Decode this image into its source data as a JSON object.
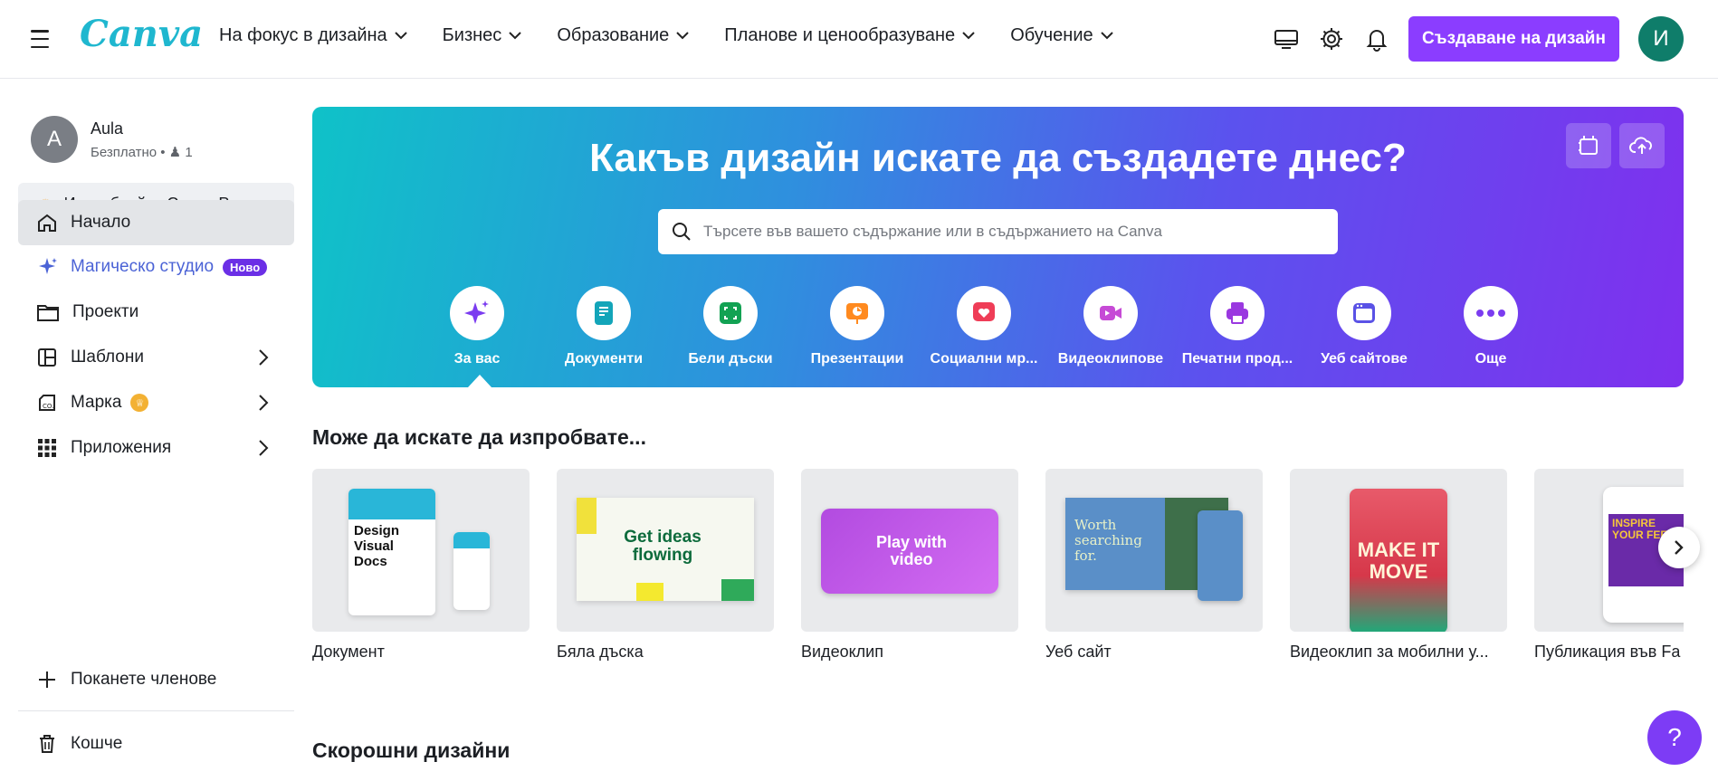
{
  "topbar": {
    "logo": "Canva",
    "nav": [
      "На фокус в дизайна",
      "Бизнес",
      "Образование",
      "Планове и ценообразуване",
      "Обучение"
    ],
    "create_label": "Създаване на дизайн",
    "avatar_letter": "И",
    "icons": [
      "desktop-icon",
      "gear-icon",
      "bell-icon"
    ]
  },
  "sidebar": {
    "user": {
      "initial": "A",
      "name": "Aula",
      "plan": "Безплатно • ",
      "members": "1"
    },
    "pro_label": "Изпробвайте Canva Pro",
    "items": [
      {
        "label": "Начало"
      },
      {
        "label": "Магическо студио",
        "badge": "Ново"
      },
      {
        "label": "Проекти"
      },
      {
        "label": "Шаблони"
      },
      {
        "label": "Марка"
      },
      {
        "label": "Приложения"
      }
    ],
    "invite_label": "Поканете членове",
    "trash_label": "Кошче"
  },
  "hero": {
    "title": "Какъв дизайн искате да създадете днес?",
    "search_placeholder": "Търсете във вашето съдържание или в съдържанието на Canva",
    "categories": [
      {
        "label": "За вас",
        "color": "#7b3cf0"
      },
      {
        "label": "Документи",
        "color": "#13a5b9"
      },
      {
        "label": "Бели дъски",
        "color": "#12a253"
      },
      {
        "label": "Презентации",
        "color": "#ff8a1f"
      },
      {
        "label": "Социални мр...",
        "color": "#ef3d57"
      },
      {
        "label": "Видеоклипове",
        "color": "#c64ad6"
      },
      {
        "label": "Печатни прод...",
        "color": "#9a38e0"
      },
      {
        "label": "Уеб сайтове",
        "color": "#5a52e6"
      },
      {
        "label": "Още",
        "color": "#7b3cf0"
      }
    ]
  },
  "suggest": {
    "title": "Може да искате да изпробвате...",
    "cards": [
      {
        "label": "Документ",
        "thumb_text": "Design Visual Docs"
      },
      {
        "label": "Бяла дъска",
        "thumb_text": "Get ideas flowing"
      },
      {
        "label": "Видеоклип",
        "thumb_text": "Play with video"
      },
      {
        "label": "Уеб сайт",
        "thumb_text": "Worth searching for."
      },
      {
        "label": "Видеоклип за мобилни у...",
        "thumb_text": "MAKE IT MOVE"
      },
      {
        "label": "Публикация във Fa",
        "thumb_text": "INSPIRE YOUR FEED"
      }
    ]
  },
  "recent": {
    "title": "Скорошни дизайни"
  },
  "help_label": "?"
}
